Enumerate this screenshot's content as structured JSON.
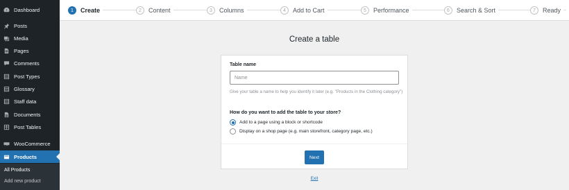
{
  "sidebar": {
    "items": [
      {
        "label": "Dashboard",
        "icon": "dashboard-icon"
      },
      {
        "label": "Posts",
        "icon": "pin-icon"
      },
      {
        "label": "Media",
        "icon": "media-icon"
      },
      {
        "label": "Pages",
        "icon": "pages-icon"
      },
      {
        "label": "Comments",
        "icon": "comment-icon"
      },
      {
        "label": "Post Types",
        "icon": "list-icon"
      },
      {
        "label": "Glossary",
        "icon": "list-icon"
      },
      {
        "label": "Staff data",
        "icon": "list-icon"
      },
      {
        "label": "Documents",
        "icon": "document-icon"
      },
      {
        "label": "Post Tables",
        "icon": "table-icon"
      },
      {
        "label": "WooCommerce",
        "icon": "woocommerce-icon"
      },
      {
        "label": "Products",
        "icon": "products-icon"
      }
    ],
    "submenu": [
      "All Products",
      "Add new product"
    ]
  },
  "stepper": {
    "steps": [
      {
        "num": "1",
        "label": "Create"
      },
      {
        "num": "2",
        "label": "Content"
      },
      {
        "num": "3",
        "label": "Columns"
      },
      {
        "num": "4",
        "label": "Add to Cart"
      },
      {
        "num": "5",
        "label": "Performance"
      },
      {
        "num": "6",
        "label": "Search & Sort"
      },
      {
        "num": "7",
        "label": "Ready"
      }
    ]
  },
  "main": {
    "title": "Create a table",
    "table_name_label": "Table name",
    "table_name_placeholder": "Name",
    "table_name_value": "",
    "help_text": "Give your table a name to help you identify it later (e.g. \"Products in the Clothing category\")",
    "question": "How do you want to add the table to your store?",
    "options": [
      {
        "label": "Add to a page using a block or shortcode",
        "checked": true
      },
      {
        "label": "Display on a shop page (e.g. main storefront, category page, etc.)",
        "checked": false
      }
    ],
    "next_label": "Next",
    "exit_label": "Exit"
  },
  "colors": {
    "accent": "#2271b1",
    "sidebar_bg": "#1d2327",
    "page_bg": "#f0f0f1"
  }
}
